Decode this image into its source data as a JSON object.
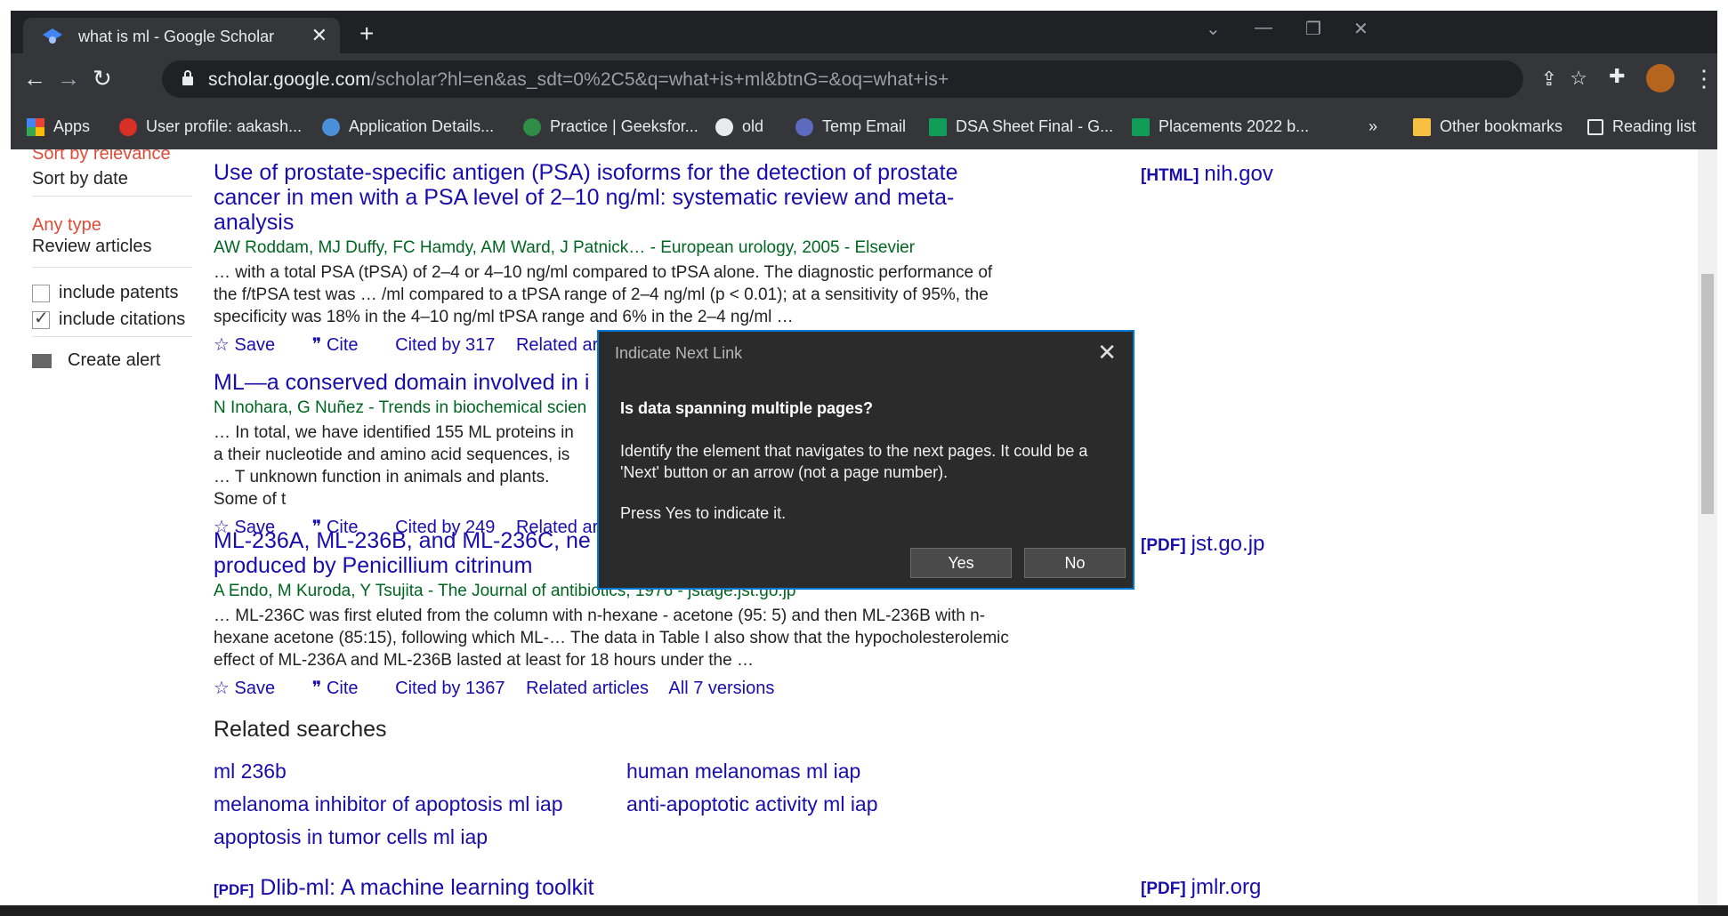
{
  "browser": {
    "tab_title": "what is ml - Google Scholar",
    "url_host": "scholar.google.com",
    "url_path": "/scholar?hl=en&as_sdt=0%2C5&q=what+is+ml&btnG=&oq=what+is+",
    "bookmarks": [
      "Apps",
      "User profile: aakash...",
      "Application Details...",
      "Practice | Geeksfor...",
      "old",
      "Temp Email",
      "DSA Sheet Final - G...",
      "Placements 2022 b..."
    ],
    "overflow": "»",
    "other_bookmarks": "Other bookmarks",
    "reading_list": "Reading list"
  },
  "sidebar": {
    "sort_relevance": "Sort by relevance",
    "sort_date": "Sort by date",
    "any_type": "Any type",
    "review_articles": "Review articles",
    "include_patents": "include patents",
    "include_citations": "include citations",
    "create_alert": "Create alert"
  },
  "results": [
    {
      "title": "Use of prostate-specific antigen (PSA) isoforms for the detection of prostate cancer in men with a PSA level of 2–10 ng/ml: systematic review and meta-analysis",
      "authors": "AW Roddam, MJ Duffy, FC Hamdy, AM Ward, J Patnick… - European urology, 2005 - Elsevier",
      "snippet": "… with a total PSA (tPSA) of 2–4 or 4–10 ng/ml compared to tPSA alone. The diagnostic performance of the f/tPSA test was … /ml compared to a tPSA range of 2–4 ng/ml (p < 0.01); at a sensitivity of 95%, the specificity was 18% in the 4–10 ng/ml tPSA range and 6% in the 2–4 ng/ml …",
      "save": "Save",
      "cite": "Cite",
      "cited_by": "Cited by 317",
      "related": "Related articles",
      "side_tag": "[HTML]",
      "side_link": "nih.gov"
    },
    {
      "title": "ML—a conserved domain involved in i",
      "authors": "N Inohara, G Nuñez - Trends in biochemical scien",
      "snippet": "… In total, we have identified 155 ML proteins in a their nucleotide and amino acid sequences, is … T unknown function in animals and plants. Some of t",
      "save": "Save",
      "cite": "Cite",
      "cited_by": "Cited by 249",
      "related": "Related articles"
    },
    {
      "title": "ML-236A, ML-236B, and ML-236C, ne produced by Penicillium citrinum",
      "authors": "A Endo, M Kuroda, Y Tsujita - The Journal of antibiotics, 1976 - jstage.jst.go.jp",
      "snippet": "… ML-236C was first eluted from the column with n-hexane - acetone (95: 5) and then ML-236B with n-hexane acetone (85:15), following which ML-… The data in Table I also show that the hypocholesterolemic effect of ML-236A and ML-236B lasted at least for 18 hours under the …",
      "save": "Save",
      "cite": "Cite",
      "cited_by": "Cited by 1367",
      "related": "Related articles",
      "versions": "All 7 versions",
      "side_tag": "[PDF]",
      "side_link": "jst.go.jp"
    }
  ],
  "related_searches": {
    "heading": "Related searches",
    "items": [
      "ml 236b",
      "human melanomas ml iap",
      "melanoma inhibitor of apoptosis ml iap",
      "anti-apoptotic activity ml iap",
      "apoptosis in tumor cells ml iap"
    ]
  },
  "next_result": {
    "tag": "[PDF]",
    "title": "Dlib-ml: A machine learning toolkit",
    "side_tag": "[PDF]",
    "side_link": "jmlr.org"
  },
  "dialog": {
    "title": "Indicate Next Link",
    "question": "Is data spanning multiple pages?",
    "body": "Identify the element that navigates to the next pages. It could be a 'Next' button or an arrow (not a page number).",
    "press": "Press Yes to indicate it.",
    "yes": "Yes",
    "no": "No"
  }
}
